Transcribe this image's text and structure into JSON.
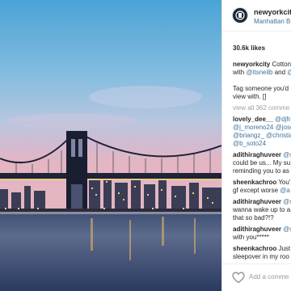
{
  "post": {
    "username": "newyorkcity",
    "location": "Manhattan B",
    "likes": "30.6k likes",
    "caption": {
      "user": "newyorkcity",
      "line1_text": " Cotton",
      "line2_pre": "with ",
      "line2_m1": "@itsneilb",
      "line2_mid": " and ",
      "line2_m2": "@",
      "line3": "Tag someone you'd",
      "line4": "view with. []"
    },
    "view_all": "view all 362 comme"
  },
  "comments": [
    {
      "user": "lovely_dee__",
      "lines": [
        {
          "spans": [
            {
              "t": "lovely_dee__",
              "c": "u"
            },
            {
              "t": " @djfra",
              "c": "m"
            }
          ]
        },
        {
          "spans": [
            {
              "t": "@j_moreno24",
              "c": "m"
            },
            {
              "t": " ",
              "c": ""
            },
            {
              "t": "@jose",
              "c": "m"
            }
          ]
        },
        {
          "spans": [
            {
              "t": "@briangz_",
              "c": "m"
            },
            {
              "t": " ",
              "c": ""
            },
            {
              "t": "@christia",
              "c": "m"
            }
          ]
        },
        {
          "spans": [
            {
              "t": "@b_soto24",
              "c": "m"
            }
          ]
        }
      ]
    },
    {
      "user": "adithiraghuveer",
      "lines": [
        {
          "spans": [
            {
              "t": "adithiraghuveer",
              "c": "u"
            },
            {
              "t": " @s",
              "c": "m"
            }
          ]
        },
        {
          "spans": [
            {
              "t": "could be us... My su",
              "c": ""
            }
          ]
        },
        {
          "spans": [
            {
              "t": "reminding you to as",
              "c": ""
            }
          ]
        }
      ]
    },
    {
      "user": "sheenkachroo",
      "lines": [
        {
          "spans": [
            {
              "t": "sheenkachroo",
              "c": "u"
            },
            {
              "t": " You'",
              "c": ""
            }
          ]
        },
        {
          "spans": [
            {
              "t": "gf except worse ",
              "c": ""
            },
            {
              "t": "@a",
              "c": "m"
            }
          ]
        }
      ]
    },
    {
      "user": "adithiraghuveer",
      "lines": [
        {
          "spans": [
            {
              "t": "adithiraghuveer",
              "c": "u"
            },
            {
              "t": " @s",
              "c": "m"
            }
          ]
        },
        {
          "spans": [
            {
              "t": "wanna wake up to a",
              "c": ""
            }
          ]
        },
        {
          "spans": [
            {
              "t": "that so bad?!?",
              "c": ""
            }
          ]
        }
      ]
    },
    {
      "user": "adithiraghuveer",
      "lines": [
        {
          "spans": [
            {
              "t": "adithiraghuveer",
              "c": "u"
            },
            {
              "t": " @s",
              "c": "m"
            }
          ]
        },
        {
          "spans": [
            {
              "t": "with you*****",
              "c": ""
            }
          ]
        }
      ]
    },
    {
      "user": "sheenkachroo",
      "lines": [
        {
          "spans": [
            {
              "t": "sheenkachroo",
              "c": "u"
            },
            {
              "t": " Just",
              "c": ""
            }
          ]
        },
        {
          "spans": [
            {
              "t": "sleepover in my roo",
              "c": ""
            }
          ]
        }
      ]
    }
  ],
  "footer": {
    "add_comment": "Add a comme"
  },
  "colors": {
    "link": "#3f729b",
    "text": "#262626",
    "muted": "#a0a0a0"
  },
  "icons": {
    "like": "heart-icon",
    "avatar": "city-logo-icon"
  }
}
